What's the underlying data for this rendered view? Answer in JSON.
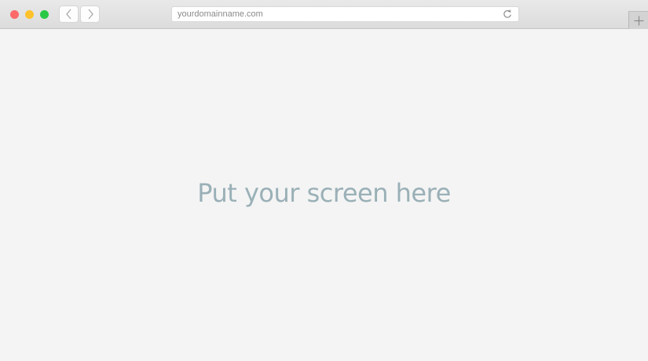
{
  "browser": {
    "window_controls": [
      {
        "name": "close",
        "color": "#fc6a6a"
      },
      {
        "name": "minimize",
        "color": "#fdc22b"
      },
      {
        "name": "maximize",
        "color": "#2ac845"
      }
    ],
    "nav": {
      "back_icon": "chevron-left-icon",
      "forward_icon": "chevron-right-icon"
    },
    "address_bar": {
      "url": "yourdomainname.com",
      "reload_icon": "reload-icon"
    },
    "new_tab_icon": "plus-icon"
  },
  "content": {
    "placeholder_text": "Put your screen here",
    "text_color": "#9ab0b7",
    "background": "#f4f4f4"
  }
}
